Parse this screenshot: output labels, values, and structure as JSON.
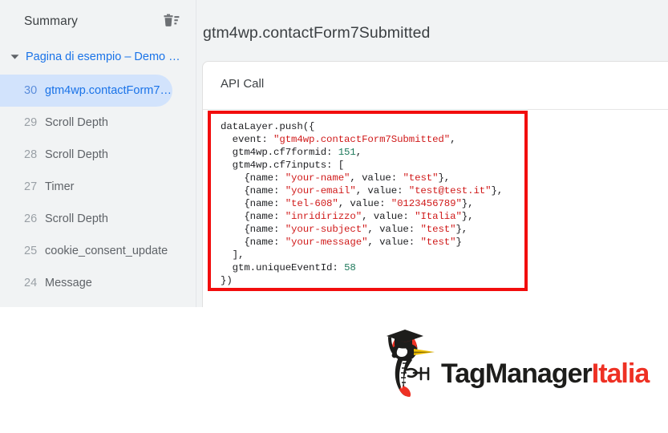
{
  "sidebar": {
    "title": "Summary",
    "clear_icon": "trash-icon",
    "group": {
      "caret_icon": "chevron-down-icon",
      "label": "Pagina di esempio – Demo …"
    },
    "events": [
      {
        "index": "30",
        "label": "gtm4wp.contactForm7S…",
        "selected": true
      },
      {
        "index": "29",
        "label": "Scroll Depth",
        "selected": false
      },
      {
        "index": "28",
        "label": "Scroll Depth",
        "selected": false
      },
      {
        "index": "27",
        "label": "Timer",
        "selected": false
      },
      {
        "index": "26",
        "label": "Scroll Depth",
        "selected": false
      },
      {
        "index": "25",
        "label": "cookie_consent_update",
        "selected": false
      },
      {
        "index": "24",
        "label": "Message",
        "selected": false
      }
    ]
  },
  "main": {
    "title": "gtm4wp.contactForm7Submitted",
    "tab_label": "API Call",
    "code": {
      "lines": [
        [
          {
            "t": "dataLayer.push({",
            "c": "plain"
          }
        ],
        [
          {
            "t": "  event: ",
            "c": "plain"
          },
          {
            "t": "\"gtm4wp.contactForm7Submitted\"",
            "c": "str"
          },
          {
            "t": ",",
            "c": "plain"
          }
        ],
        [
          {
            "t": "  gtm4wp.cf7formid: ",
            "c": "plain"
          },
          {
            "t": "151",
            "c": "num"
          },
          {
            "t": ",",
            "c": "plain"
          }
        ],
        [
          {
            "t": "  gtm4wp.cf7inputs: [",
            "c": "plain"
          }
        ],
        [
          {
            "t": "    {name: ",
            "c": "plain"
          },
          {
            "t": "\"your-name\"",
            "c": "str"
          },
          {
            "t": ", value: ",
            "c": "plain"
          },
          {
            "t": "\"test\"",
            "c": "str"
          },
          {
            "t": "},",
            "c": "plain"
          }
        ],
        [
          {
            "t": "    {name: ",
            "c": "plain"
          },
          {
            "t": "\"your-email\"",
            "c": "str"
          },
          {
            "t": ", value: ",
            "c": "plain"
          },
          {
            "t": "\"test@test.it\"",
            "c": "str"
          },
          {
            "t": "},",
            "c": "plain"
          }
        ],
        [
          {
            "t": "    {name: ",
            "c": "plain"
          },
          {
            "t": "\"tel-608\"",
            "c": "str"
          },
          {
            "t": ", value: ",
            "c": "plain"
          },
          {
            "t": "\"0123456789\"",
            "c": "str"
          },
          {
            "t": "},",
            "c": "plain"
          }
        ],
        [
          {
            "t": "    {name: ",
            "c": "plain"
          },
          {
            "t": "\"inridirizzo\"",
            "c": "str"
          },
          {
            "t": ", value: ",
            "c": "plain"
          },
          {
            "t": "\"Italia\"",
            "c": "str"
          },
          {
            "t": "},",
            "c": "plain"
          }
        ],
        [
          {
            "t": "    {name: ",
            "c": "plain"
          },
          {
            "t": "\"your-subject\"",
            "c": "str"
          },
          {
            "t": ", value: ",
            "c": "plain"
          },
          {
            "t": "\"test\"",
            "c": "str"
          },
          {
            "t": "},",
            "c": "plain"
          }
        ],
        [
          {
            "t": "    {name: ",
            "c": "plain"
          },
          {
            "t": "\"your-message\"",
            "c": "str"
          },
          {
            "t": ", value: ",
            "c": "plain"
          },
          {
            "t": "\"test\"",
            "c": "str"
          },
          {
            "t": "}",
            "c": "plain"
          }
        ],
        [
          {
            "t": "  ],",
            "c": "plain"
          }
        ],
        [
          {
            "t": "  gtm.uniqueEventId: ",
            "c": "plain"
          },
          {
            "t": "58",
            "c": "num"
          }
        ],
        [
          {
            "t": "})",
            "c": "plain"
          }
        ]
      ]
    }
  },
  "annotation": {
    "color": "#f20d0d",
    "targets": [
      "selected-event-row",
      "code-block"
    ]
  },
  "logo": {
    "icon": "woodpecker-graduate-icon",
    "text_primary": "TagManager",
    "text_accent": "Italia",
    "accent_color": "#ee3124"
  },
  "colors": {
    "panel_bg": "#f1f3f4",
    "card_bg": "#ffffff",
    "link_blue": "#1a73e8",
    "selected_bg": "#d2e3fc",
    "string_red": "#d01b1b",
    "number_green": "#1f7a5c",
    "annotation_red": "#f20d0d"
  }
}
